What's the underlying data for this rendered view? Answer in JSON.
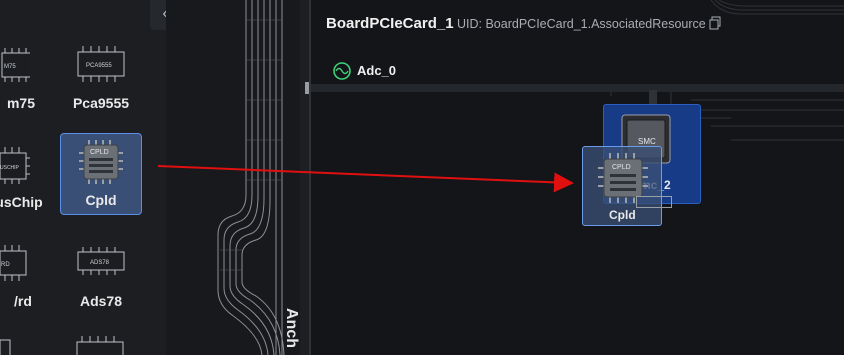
{
  "palette": {
    "collapse_icon": "chevron-left-icon",
    "items": [
      {
        "label": "m75",
        "chip_text": "M75"
      },
      {
        "label": "Pca9555",
        "chip_text": "PCA9555"
      },
      {
        "label": "usChip",
        "chip_text": "USCHIP"
      },
      {
        "label": "Cpld",
        "chip_text": "CPLD"
      },
      {
        "label": "/rd",
        "chip_text": "RD"
      },
      {
        "label": "Ads78",
        "chip_text": "ADS78"
      }
    ]
  },
  "connector": {
    "vertical_label": "Anch"
  },
  "canvas": {
    "title": "BoardPCIeCard_1",
    "uid": "UID:  BoardPCIeCard_1.AssociatedResource",
    "port": {
      "label": "Adc_0"
    },
    "smc_node": {
      "chip_text": "SMC",
      "label": "Smc_2"
    },
    "drag_ghost": {
      "chip_text": "CPLD",
      "label": "Cpld"
    }
  },
  "colors": {
    "accent": "#5b8ee6",
    "arrow": "#e01010",
    "smc_bg": "#173b86"
  }
}
